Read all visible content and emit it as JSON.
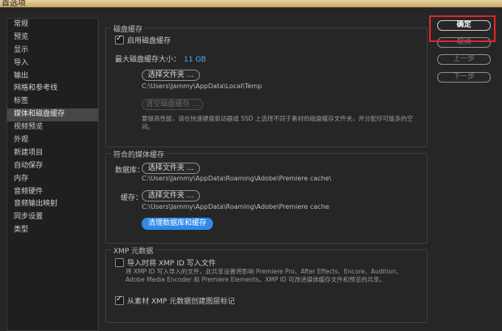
{
  "window": {
    "title": "首选项"
  },
  "sidebar": {
    "items": [
      {
        "label": "常规"
      },
      {
        "label": "预览"
      },
      {
        "label": "显示"
      },
      {
        "label": "导入"
      },
      {
        "label": "输出"
      },
      {
        "label": "网格和参考线"
      },
      {
        "label": "标签"
      },
      {
        "label": "媒体和磁盘缓存"
      },
      {
        "label": "视频预览"
      },
      {
        "label": "外观"
      },
      {
        "label": "新建项目"
      },
      {
        "label": "自动保存"
      },
      {
        "label": "内存"
      },
      {
        "label": "音频硬件"
      },
      {
        "label": "音频输出映射"
      },
      {
        "label": "同步设置"
      },
      {
        "label": "类型"
      }
    ],
    "selected_index": 7
  },
  "disk_cache": {
    "title": "磁盘缓存",
    "enable_label": "启用磁盘缓存",
    "enable_checked": true,
    "max_size_label": "最大磁盘缓存大小：",
    "max_size_value": "11 GB",
    "choose_folder_button": "选择文件夹 ...",
    "path": "C:\\Users\\Jammy\\AppData\\Local\\Temp",
    "clear_button": "清空磁盘缓存 ...",
    "note": "要提高性能，请在快速硬盘驱动器或 SSD 上选择不同于素材的磁盘缓存文件夹，并分配尽可能多的空间。"
  },
  "media_cache": {
    "title": "符合的媒体缓存",
    "database_label": "数据库：",
    "database_button": "选择文件夹 ...",
    "database_path": "C:\\Users\\Jammy\\AppData\\Roaming\\Adobe\\Premiere cache\\",
    "cache_label": "缓存：",
    "cache_button": "选择文件夹 ...",
    "cache_path": "C:\\Users\\Jammy\\AppData\\Roaming\\Adobe\\Premiere cache",
    "clean_button": "清理数据库和缓存"
  },
  "xmp": {
    "title": "XMP 元数据",
    "write_label": "导入时将 XMP ID 写入文件",
    "write_checked": false,
    "note": "将 XMP ID 写入导入的文件，此共享设置将影响 Premiere Pro、After Effects、Encore、Audition、Adobe Media Encoder 和 Premiere Elements。XMP ID 可改进媒体缓存文件和预览的共享。",
    "create_label": "从素材 XMP 元数据创建图层标记",
    "create_checked": true
  },
  "actions": {
    "ok": "确定",
    "cancel": "取消",
    "prev": "上一步",
    "next": "下一步"
  },
  "colors": {
    "accent": "#4da8ff",
    "highlight": "#e0262a",
    "selected_bg": "#474747"
  }
}
